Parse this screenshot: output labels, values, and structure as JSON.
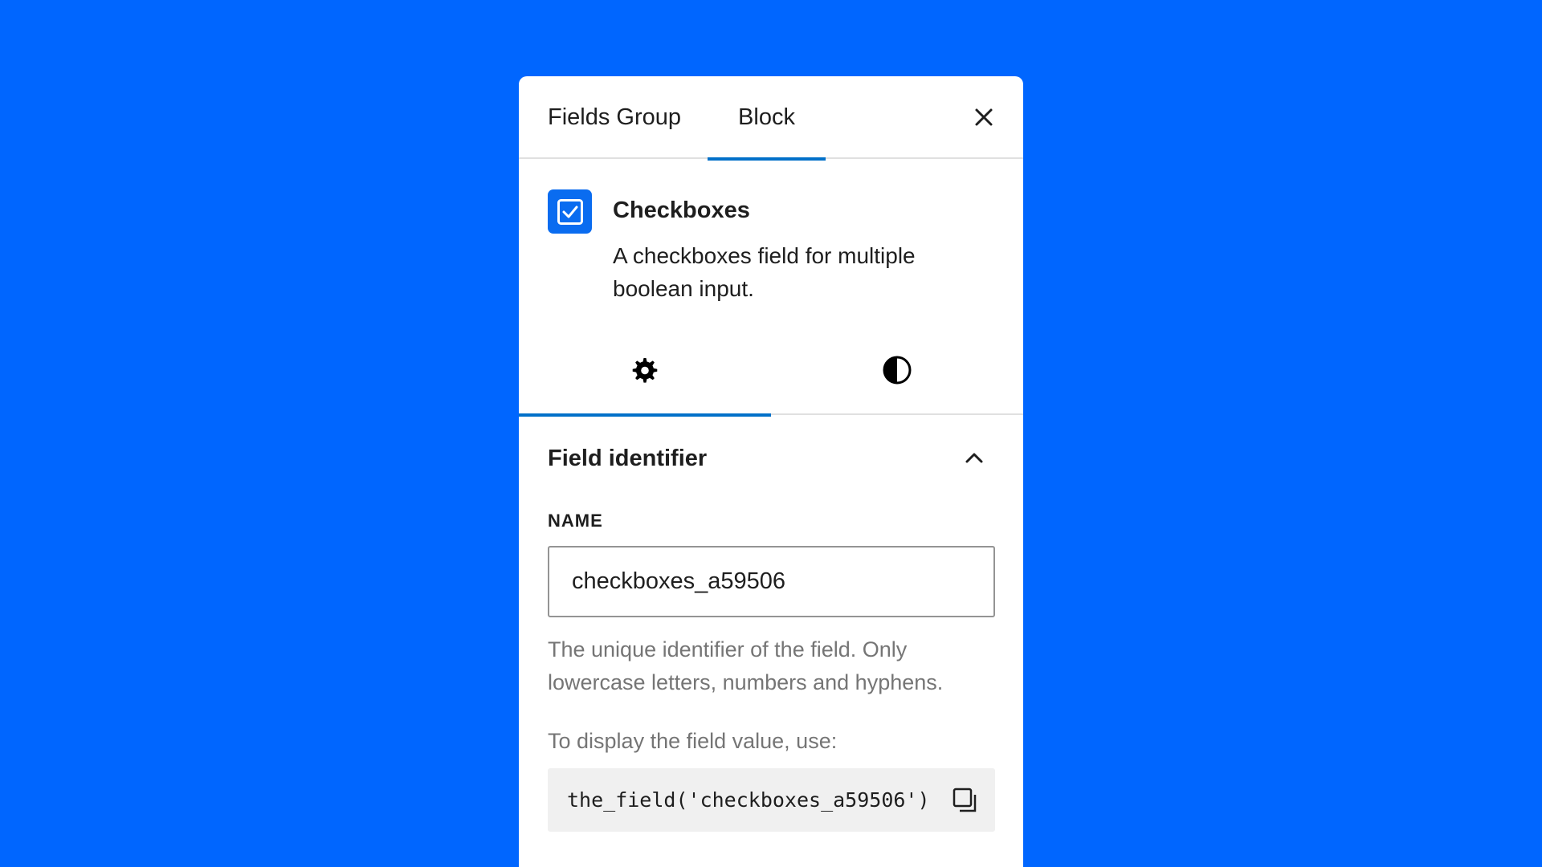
{
  "header": {
    "tabs": [
      {
        "label": "Fields Group",
        "active": false
      },
      {
        "label": "Block",
        "active": true
      }
    ],
    "close_icon": "close-icon"
  },
  "block": {
    "icon": "checkbox-checked-icon",
    "title": "Checkboxes",
    "description": "A checkboxes field for multiple boolean input."
  },
  "subtabs": [
    {
      "icon": "gear-icon",
      "active": true
    },
    {
      "icon": "contrast-icon",
      "active": false
    }
  ],
  "field_identifier": {
    "title": "Field identifier",
    "expanded": true,
    "name_label": "NAME",
    "name_value": "checkboxes_a59506",
    "help_text": "The unique identifier of the field. Only lowercase letters, numbers and hyphens.",
    "display_label": "To display the field value, use:",
    "code": "the_field('checkboxes_a59506')",
    "copy_icon": "copy-icon"
  },
  "colors": {
    "background": "#0066ff",
    "accent": "#0070c9",
    "icon_bg": "#0a6cf0"
  }
}
